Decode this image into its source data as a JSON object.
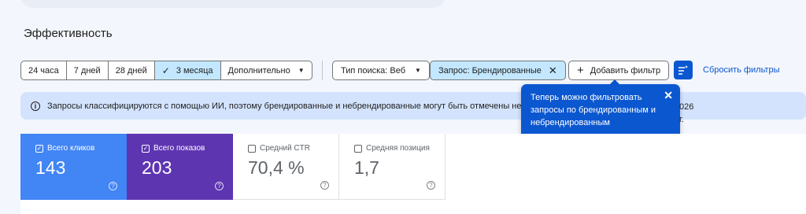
{
  "section_title": "Эффективность",
  "date_range": {
    "options": [
      "24 часа",
      "7 дней",
      "28 дней",
      "3 месяца",
      "Дополнительно"
    ],
    "selected": "3 месяца"
  },
  "filters": {
    "search_type": "Тип поиска: Веб",
    "query": "Запрос: Брендированные",
    "add_filter": "Добавить фильтр",
    "reset": "Сбросить фильтры"
  },
  "info_banner": "Запросы классифицируются с помощью ИИ, поэтому брендированные и небрендированные могут быть отмечены невер",
  "info_banner_tail": "026 г.",
  "tooltip": {
    "text": "Теперь можно фильтровать запросы по брендированным и небрендированным"
  },
  "metrics": [
    {
      "label": "Всего кликов",
      "value": "143",
      "checked": true
    },
    {
      "label": "Всего показов",
      "value": "203",
      "checked": true
    },
    {
      "label": "Средний CTR",
      "value": "70,4 %",
      "checked": false
    },
    {
      "label": "Средняя позиция",
      "value": "1,7",
      "checked": false
    }
  ],
  "colors": {
    "accent": "#0b57d0",
    "selected_chip": "#c2e7ff",
    "clicks": "#4285f4",
    "impressions": "#5e35b1",
    "banner": "#d3e3fd"
  },
  "icons": {
    "check": "check-icon",
    "dropdown": "chevron-down-icon",
    "remove": "close-icon",
    "add": "plus-icon",
    "filter_settings": "filter-settings-icon",
    "info": "info-icon",
    "help": "help-icon"
  }
}
